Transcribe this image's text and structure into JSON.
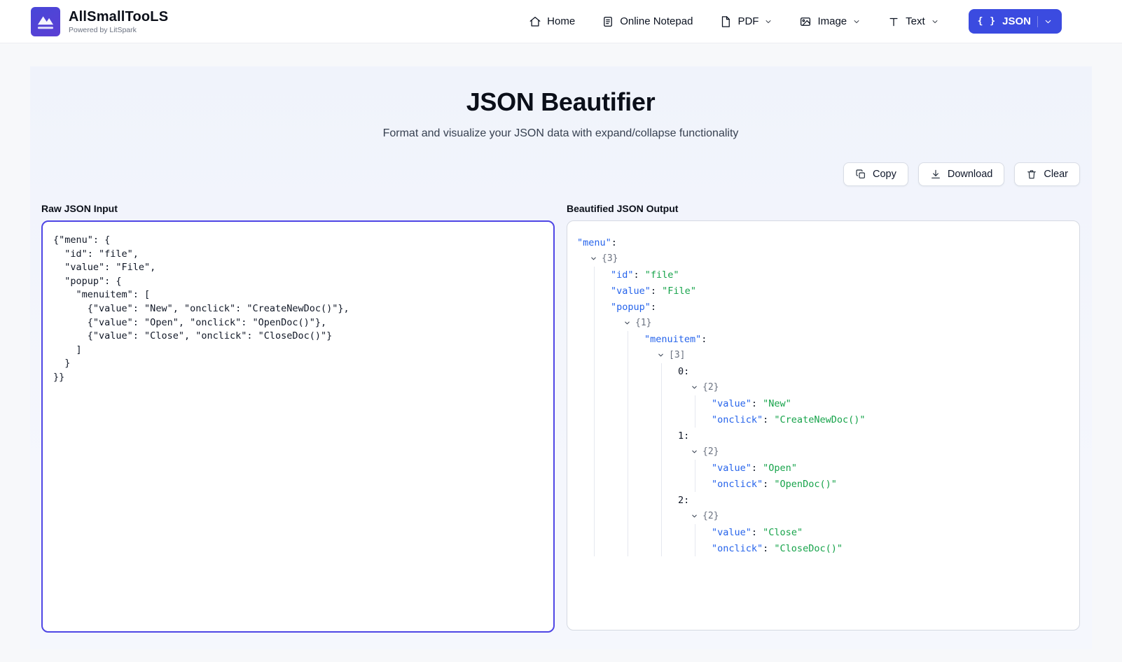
{
  "header": {
    "brand": {
      "title": "AllSmallTooLS",
      "subtitle": "Powered by LitSpark"
    },
    "nav": [
      {
        "label": "Home",
        "icon": "home-icon",
        "chevron": false
      },
      {
        "label": "Online Notepad",
        "icon": "notepad-icon",
        "chevron": false
      },
      {
        "label": "PDF",
        "icon": "pdf-icon",
        "chevron": true
      },
      {
        "label": "Image",
        "icon": "image-icon",
        "chevron": true
      },
      {
        "label": "Text",
        "icon": "text-icon",
        "chevron": true
      }
    ],
    "json_button": {
      "label": "JSON",
      "color": "#3b4be0"
    }
  },
  "hero": {
    "title": "JSON Beautifier",
    "subtitle": "Format and visualize your JSON data with expand/collapse functionality"
  },
  "toolbar": {
    "copy": "Copy",
    "download": "Download",
    "clear": "Clear"
  },
  "input": {
    "label": "Raw JSON Input",
    "border_color": "#4f46e5",
    "value": "{\"menu\": {\n  \"id\": \"file\",\n  \"value\": \"File\",\n  \"popup\": {\n    \"menuitem\": [\n      {\"value\": \"New\", \"onclick\": \"CreateNewDoc()\"},\n      {\"value\": \"Open\", \"onclick\": \"OpenDoc()\"},\n      {\"value\": \"Close\", \"onclick\": \"CloseDoc()\"}\n    ]\n  }\n}}"
  },
  "output": {
    "label": "Beautified JSON Output",
    "colors": {
      "key": "#2563eb",
      "string": "#16a34a",
      "badge": "#6b7280",
      "index": "#111827"
    },
    "tree": [
      {
        "depth": 0,
        "key": "menu"
      },
      {
        "depth": 0,
        "badge": "{3}"
      },
      {
        "depth": 1,
        "key": "id",
        "value": "file"
      },
      {
        "depth": 1,
        "key": "value",
        "value": "File"
      },
      {
        "depth": 1,
        "key": "popup"
      },
      {
        "depth": 1,
        "badge": "{1}"
      },
      {
        "depth": 2,
        "key": "menuitem"
      },
      {
        "depth": 2,
        "badge": "[3]"
      },
      {
        "depth": 3,
        "index": "0:"
      },
      {
        "depth": 3,
        "badge": "{2}"
      },
      {
        "depth": 4,
        "key": "value",
        "value": "New"
      },
      {
        "depth": 4,
        "key": "onclick",
        "value": "CreateNewDoc()"
      },
      {
        "depth": 3,
        "index": "1:"
      },
      {
        "depth": 3,
        "badge": "{2}"
      },
      {
        "depth": 4,
        "key": "value",
        "value": "Open"
      },
      {
        "depth": 4,
        "key": "onclick",
        "value": "OpenDoc()"
      },
      {
        "depth": 3,
        "index": "2:"
      },
      {
        "depth": 3,
        "badge": "{2}"
      },
      {
        "depth": 4,
        "key": "value",
        "value": "Close"
      },
      {
        "depth": 4,
        "key": "onclick",
        "value": "CloseDoc()"
      }
    ]
  }
}
